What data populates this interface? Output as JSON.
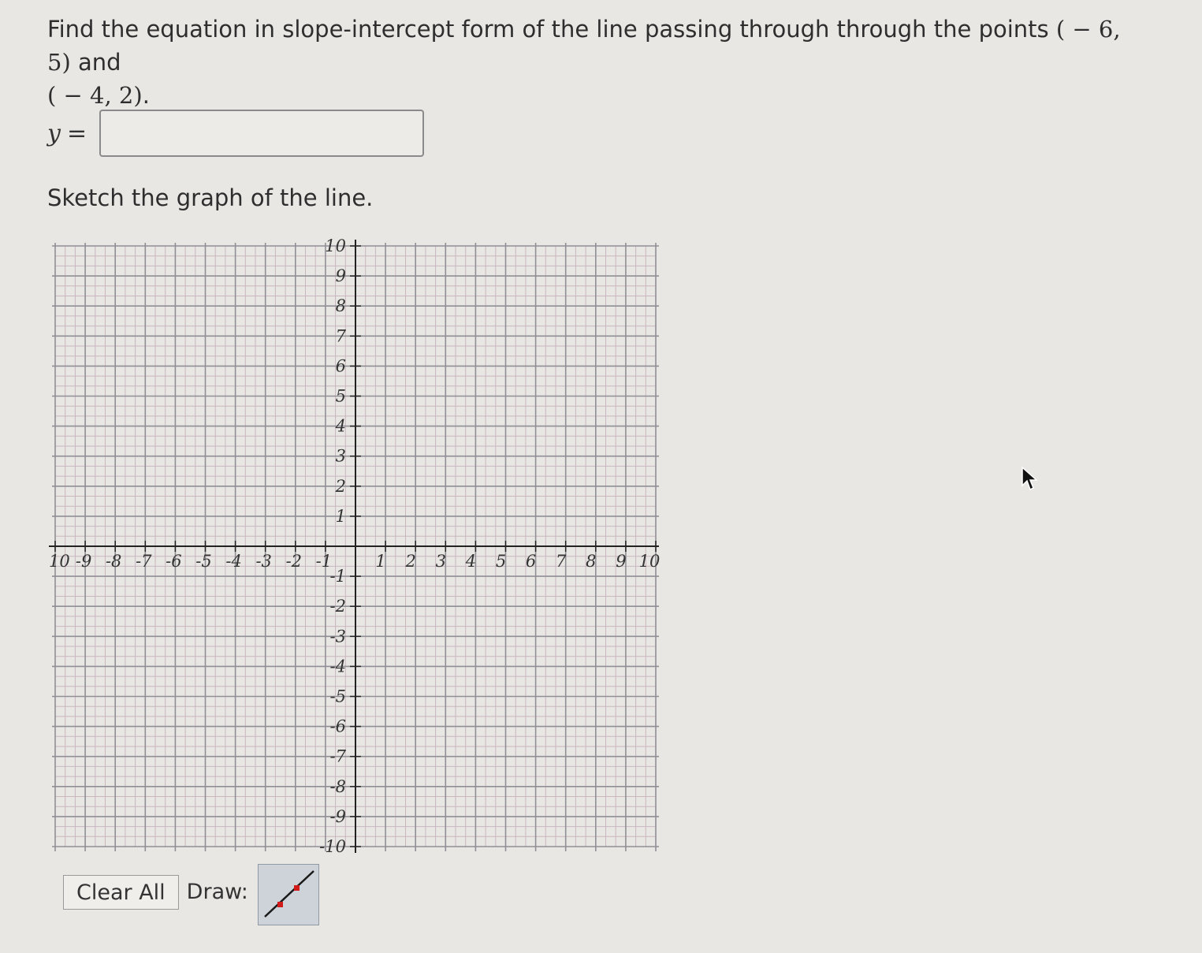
{
  "question": {
    "prefix": "Find the equation in slope-intercept form of the line passing through through the points ",
    "point1": "( − 6, 5)",
    "middle": " and ",
    "point2": "( − 4, 2)",
    "suffix": "."
  },
  "answer": {
    "label": "y",
    "equals": "=",
    "value": "",
    "placeholder": ""
  },
  "sketch_prompt": "Sketch the graph of the line.",
  "graph": {
    "x_min": -10,
    "x_max": 10,
    "y_min": -10,
    "y_max": 10,
    "minor_divisions_per_unit": 3,
    "x_tick_labels": [
      "10",
      "-9",
      "-8",
      "-7",
      "-6",
      "-5",
      "-4",
      "-3",
      "-2",
      "-1",
      "1",
      "2",
      "3",
      "4",
      "5",
      "6",
      "7",
      "8",
      "9",
      "10"
    ],
    "y_tick_labels": [
      "10",
      "9",
      "8",
      "7",
      "6",
      "5",
      "4",
      "3",
      "2",
      "1",
      "-1",
      "-2",
      "-3",
      "-4",
      "-5",
      "-6",
      "-7",
      "-8",
      "-9",
      "-10"
    ],
    "major_grid_color": "#8f8f95",
    "minor_grid_color": "#c9b6bf",
    "axis_color": "#222222"
  },
  "toolbar": {
    "clear_label": "Clear All",
    "draw_label": "Draw:",
    "line_tool_icon": "line-segment-icon",
    "point_color": "#d11a1a"
  },
  "cursor": "arrow-cursor-icon"
}
